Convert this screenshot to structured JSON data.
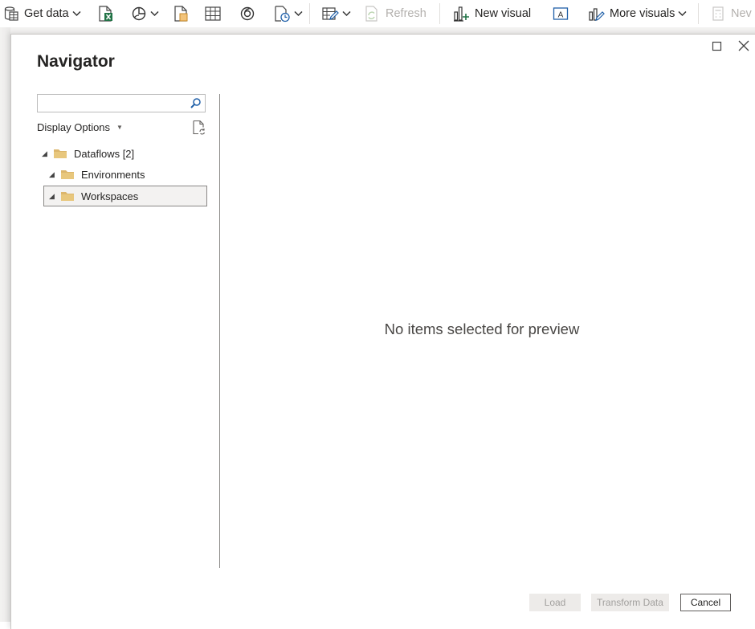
{
  "ribbon": {
    "get_data": "Get data",
    "refresh": "Refresh",
    "new_visual": "New visual",
    "more_visuals": "More visuals",
    "new_cutoff": "Nev"
  },
  "dialog": {
    "title": "Navigator",
    "search": {
      "value": "",
      "placeholder": ""
    },
    "display_options": "Display Options",
    "tree": [
      {
        "label": "Dataflows [2]",
        "level": 0
      },
      {
        "label": "Environments",
        "level": 1
      },
      {
        "label": "Workspaces",
        "level": 1,
        "selected": true
      }
    ],
    "preview_empty": "No items selected for preview",
    "buttons": {
      "load": "Load",
      "transform": "Transform Data",
      "cancel": "Cancel"
    }
  },
  "colors": {
    "folder": "#dcb66c",
    "excel_green": "#217346",
    "accent_blue": "#1f5fa8",
    "disabled_text": "#b3b0ad"
  }
}
